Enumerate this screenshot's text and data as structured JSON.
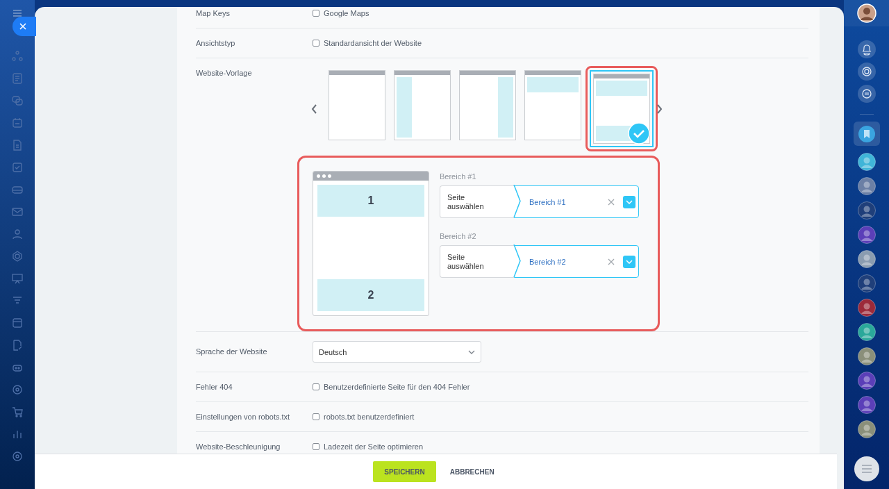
{
  "settings": [
    {
      "kind": "checkbox",
      "label": "Map Keys",
      "option": "Google Maps",
      "checked": false
    },
    {
      "kind": "checkbox",
      "label": "Ansichtstyp",
      "option": "Standardansicht der Website",
      "checked": false
    },
    {
      "kind": "template",
      "label": "Website-Vorlage",
      "templates": [
        {
          "kind": "blank",
          "selected": false,
          "highlighted": false
        },
        {
          "kind": "left",
          "selected": false,
          "highlighted": false
        },
        {
          "kind": "right",
          "selected": false,
          "highlighted": false
        },
        {
          "kind": "header",
          "selected": false,
          "highlighted": false
        },
        {
          "kind": "header-footer",
          "selected": true,
          "highlighted": true
        }
      ],
      "areas_panel": {
        "highlighted": true,
        "preview_areas": [
          "1",
          "2"
        ],
        "areas": [
          {
            "label": "Bereich #1",
            "prefix": "Seite auswählen",
            "value": "Bereich #1"
          },
          {
            "label": "Bereich #2",
            "prefix": "Seite auswählen",
            "value": "Bereich #2"
          }
        ]
      }
    },
    {
      "kind": "select",
      "label": "Sprache der Website",
      "value": "Deutsch"
    },
    {
      "kind": "checkbox",
      "label": "Fehler 404",
      "option": "Benutzerdefinierte Seite für den 404 Fehler",
      "checked": false
    },
    {
      "kind": "checkbox",
      "label": "Einstellungen von robots.txt",
      "option": "robots.txt benutzerdefiniert",
      "checked": false
    },
    {
      "kind": "checkbox",
      "label": "Website-Beschleunigung",
      "option": "Ladezeit der Seite optimieren",
      "checked": false
    }
  ],
  "footer": {
    "buttons": [
      {
        "kind": "primary",
        "label": "SPEICHERN"
      },
      {
        "kind": "link",
        "label": "ABBRECHEN"
      }
    ]
  }
}
